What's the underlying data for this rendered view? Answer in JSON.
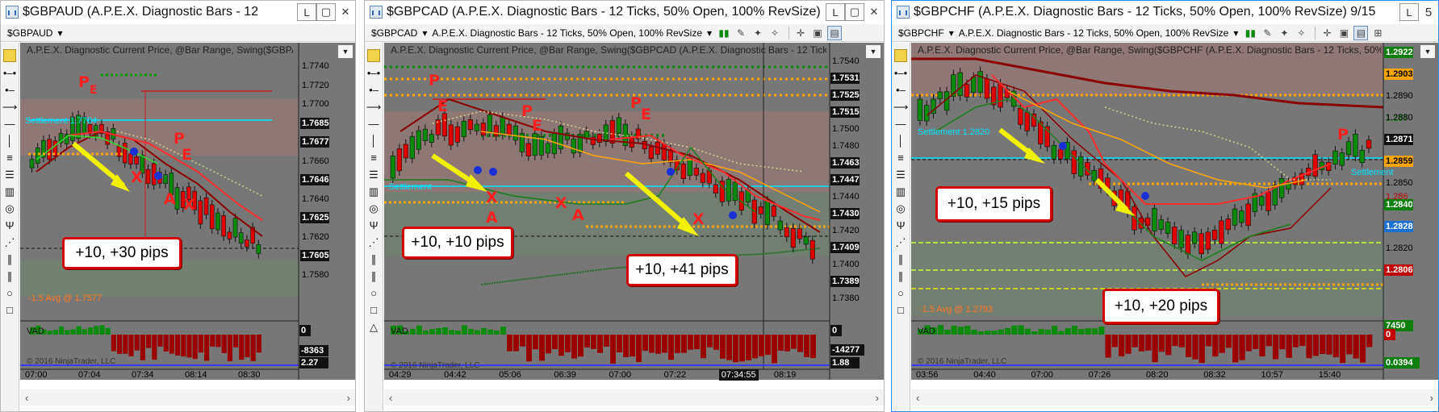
{
  "windows": [
    {
      "title": "$GBPAUD (A.P.E.X. Diagnostic Bars - 12",
      "instrument": "$GBPAUD",
      "study_caption": "A.P.E.X. Diagnostic Current Price, @Bar Range, Swing($GBPAUD (",
      "settlement_label": "Settlement 1.7704",
      "avg_label": "-1.5 Avg @ 1.7577",
      "callout": "+10, +30 pips",
      "price_labels": [
        {
          "text": "1.7740",
          "style": "plain"
        },
        {
          "text": "1.7720",
          "style": "plain"
        },
        {
          "text": "1.7700",
          "style": "plain"
        },
        {
          "text": "1.7685",
          "style": "black"
        },
        {
          "text": "1.7677",
          "style": "black"
        },
        {
          "text": "1.7660",
          "style": "plain"
        },
        {
          "text": "1.7646",
          "style": "black"
        },
        {
          "text": "1.7640",
          "style": "plain"
        },
        {
          "text": "1.7625",
          "style": "black"
        },
        {
          "text": "1.7620",
          "style": "plain"
        },
        {
          "text": "1.7605",
          "style": "black"
        },
        {
          "text": "1.7580",
          "style": "plain"
        }
      ],
      "vad_label": "VAD",
      "vad_values": [
        "0",
        "-8363",
        "2.27",
        "0"
      ],
      "copyright": "© 2016 NinjaTrader, LLC",
      "times": [
        "07:00",
        "07:04",
        "07:34",
        "08:14",
        "08:30"
      ],
      "markers": [
        "P",
        "E",
        "E",
        "P",
        "E",
        "X",
        "A",
        "X"
      ]
    },
    {
      "title": "$GBPCAD (A.P.E.X. Diagnostic Bars - 12 Ticks, 50% Open, 100% RevSize)",
      "instrument": "$GBPCAD",
      "toolbar_template": "A.P.E.X. Diagnostic Bars - 12 Ticks, 50% Open, 100% RevSize",
      "study_caption": "A.P.E.X. Diagnostic Current Price, @Bar Range, Swing($GBPCAD (A.P.E.X. Diagnostic Bars - 12 Ticks, 50% Op",
      "settlement_label": "Settlement",
      "callout_a": "+10, +10 pips",
      "callout_b": "+10, +41 pips",
      "price_labels": [
        {
          "text": "1.7540",
          "style": "plain"
        },
        {
          "text": "1.7531",
          "style": "black"
        },
        {
          "text": "1.7525",
          "style": "black"
        },
        {
          "text": "1.7515",
          "style": "black"
        },
        {
          "text": "1.7500",
          "style": "plain"
        },
        {
          "text": "1.7480",
          "style": "plain"
        },
        {
          "text": "1.7463",
          "style": "black"
        },
        {
          "text": "1.7447",
          "style": "black"
        },
        {
          "text": "1.7440",
          "style": "plain"
        },
        {
          "text": "1.7430",
          "style": "black"
        },
        {
          "text": "1.7420",
          "style": "plain"
        },
        {
          "text": "1.7409",
          "style": "black"
        },
        {
          "text": "1.7400",
          "style": "plain"
        },
        {
          "text": "1.7389",
          "style": "black"
        },
        {
          "text": "1.7380",
          "style": "plain"
        }
      ],
      "vad_label": "VAD",
      "vad_values": [
        "0",
        "-14277",
        "1.88",
        "0"
      ],
      "copyright": "© 2016 NinjaTrader, LLC",
      "times": [
        "04:29",
        "04:42",
        "05:06",
        "06:39",
        "07:00",
        "07:22",
        "07:34:55",
        "08:19"
      ],
      "markers": [
        "P",
        "E",
        "P",
        "E",
        "P",
        "E",
        "X",
        "A",
        "X",
        "A",
        "X"
      ]
    },
    {
      "title": "$GBPCHF (A.P.E.X. Diagnostic Bars - 12 Ticks, 50% Open, 100% RevSize)  9/15",
      "title_suffix": "5",
      "instrument": "$GBPCHF",
      "toolbar_template": "A.P.E.X. Diagnostic Bars - 12 Ticks, 50% Open, 100% RevSize",
      "study_caption": "A.P.E.X. Diagnostic Current Price, @Bar Range, Swing($GBPCHF (A.P.E.X. Diagnostic Bars - 12 Ticks, 50% Open, 1(",
      "settlement_label": "Settlement 1.2820",
      "settlement_label_b": "Settlement",
      "avg_label": "-1.5 Avg @ 1.2793",
      "callout_a": "+10, +15 pips",
      "callout_b": "+10, +20 pips",
      "price_labels": [
        {
          "text": "1.2922",
          "style": "green"
        },
        {
          "text": "1.2903",
          "style": "orange"
        },
        {
          "text": "1.2890",
          "style": "plain"
        },
        {
          "text": "1.2880",
          "style": "plain"
        },
        {
          "text": "1.2871",
          "style": "black"
        },
        {
          "text": "1.2859",
          "style": "orange"
        },
        {
          "text": "1.2850",
          "style": "plain"
        },
        {
          "text": "1.2840",
          "style": "green"
        },
        {
          "text": "1.2828",
          "style": "blue"
        },
        {
          "text": "1.2820",
          "style": "plain"
        },
        {
          "text": "1.2806",
          "style": "red"
        }
      ],
      "side_labels": [
        "1.287",
        "1.286"
      ],
      "vad_label": "VAD",
      "vad_values": [
        "7450",
        "0",
        "0.0394"
      ],
      "copyright": "© 2016 NinjaTrader, LLC",
      "times": [
        "03:56",
        "04:40",
        "07:00",
        "07:26",
        "08:20",
        "08:32",
        "10:57",
        "15:40"
      ],
      "markers": [
        "P"
      ]
    }
  ],
  "toolbar_icons": [
    "bar-type-icon",
    "drawing-pen-icon",
    "zoom-in-icon",
    "zoom-out-icon",
    "crosshair-icon",
    "properties-icon",
    "strategy-icon"
  ],
  "left_tools": [
    "text-tool-icon",
    "line-tool-icon",
    "ray-tool-icon",
    "arrow-tool-icon",
    "horizontal-line-icon",
    "vertical-line-icon",
    "fibonacci-icon",
    "gann-fan-icon",
    "regression-icon",
    "pitchfork-icon",
    "andrews-icon",
    "channel-icon",
    "ellipse-icon",
    "rectangle-icon",
    "triangle-icon"
  ],
  "colors": {
    "chart_bg": "#777777",
    "up_bar": "#0a8a0a",
    "down_bar": "#e00000",
    "callout_border": "#d40000",
    "arrow": "#f2f200",
    "settlement": "#00e5ff",
    "accent_window": "#1e90ff"
  }
}
